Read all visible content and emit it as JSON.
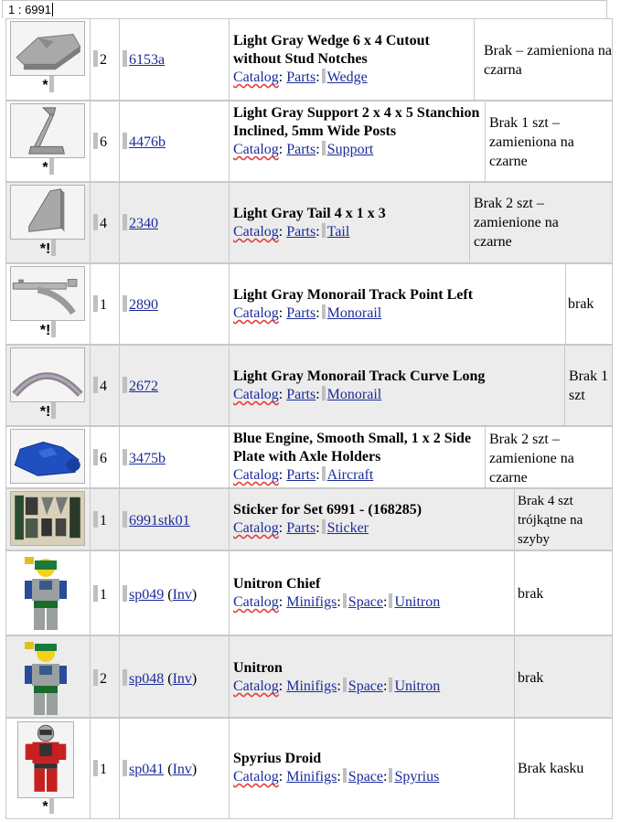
{
  "top_cell": "1 : 6991",
  "rows": [
    {
      "marks": "*",
      "qty": "2",
      "part": "6153a",
      "inv": "",
      "title": "Light Gray Wedge 6 x 4 Cutout without Stud Notches",
      "catalog": [
        "Catalog",
        "Parts",
        "Wedge"
      ],
      "note": "Brak – zamieniona na czarna"
    },
    {
      "marks": "*",
      "qty": "6",
      "part": "4476b",
      "inv": "",
      "title": "Light Gray Support 2 x 4 x 5 Stanchion Inclined, 5mm Wide Posts",
      "catalog": [
        "Catalog",
        "Parts",
        "Support"
      ],
      "note": "Brak 1 szt – zamieniona na czarne"
    },
    {
      "marks": "*!",
      "qty": "4",
      "part": "2340",
      "inv": "",
      "title": "Light Gray Tail 4 x 1 x 3",
      "catalog": [
        "Catalog",
        "Parts",
        "Tail"
      ],
      "note": "Brak 2 szt – zamienione na czarne"
    },
    {
      "marks": "*!",
      "qty": "1",
      "part": "2890",
      "inv": "",
      "title": "Light Gray Monorail Track Point Left",
      "catalog": [
        "Catalog",
        "Parts",
        "Monorail"
      ],
      "note": "brak"
    },
    {
      "marks": "*!",
      "qty": "4",
      "part": "2672",
      "inv": "",
      "title": "Light Gray Monorail Track Curve Long",
      "catalog": [
        "Catalog",
        "Parts",
        "Monorail"
      ],
      "note": "Brak 1 szt"
    },
    {
      "marks": "",
      "qty": "6",
      "part": "3475b",
      "inv": "",
      "title": "Blue Engine, Smooth Small, 1 x 2 Side Plate with Axle Holders",
      "catalog": [
        "Catalog",
        "Parts",
        "Aircraft"
      ],
      "note": "Brak 2 szt – zamienione na czarne"
    },
    {
      "marks": "",
      "qty": "1",
      "part": "6991stk01",
      "inv": "",
      "title": "Sticker for Set 6991 - (168285)",
      "catalog": [
        "Catalog",
        "Parts",
        "Sticker"
      ],
      "note": "Brak 4 szt trójkątne na szyby"
    },
    {
      "marks": "",
      "qty": "1",
      "part": "sp049",
      "inv": "Inv",
      "title": "Unitron Chief",
      "catalog": [
        "Catalog",
        "Minifigs",
        "Space",
        "Unitron"
      ],
      "note": "brak"
    },
    {
      "marks": "",
      "qty": "2",
      "part": "sp048",
      "inv": "Inv",
      "title": "Unitron",
      "catalog": [
        "Catalog",
        "Minifigs",
        "Space",
        "Unitron"
      ],
      "note": "brak"
    },
    {
      "marks": "*",
      "qty": "1",
      "part": "sp041",
      "inv": "Inv",
      "title": "Spyrius Droid",
      "catalog": [
        "Catalog",
        "Minifigs",
        "Space",
        "Spyrius"
      ],
      "note": "Brak kasku"
    }
  ],
  "colors": {
    "link": "#1a2b9a",
    "row_alt": "#ececec",
    "border": "#c8c8c8"
  }
}
